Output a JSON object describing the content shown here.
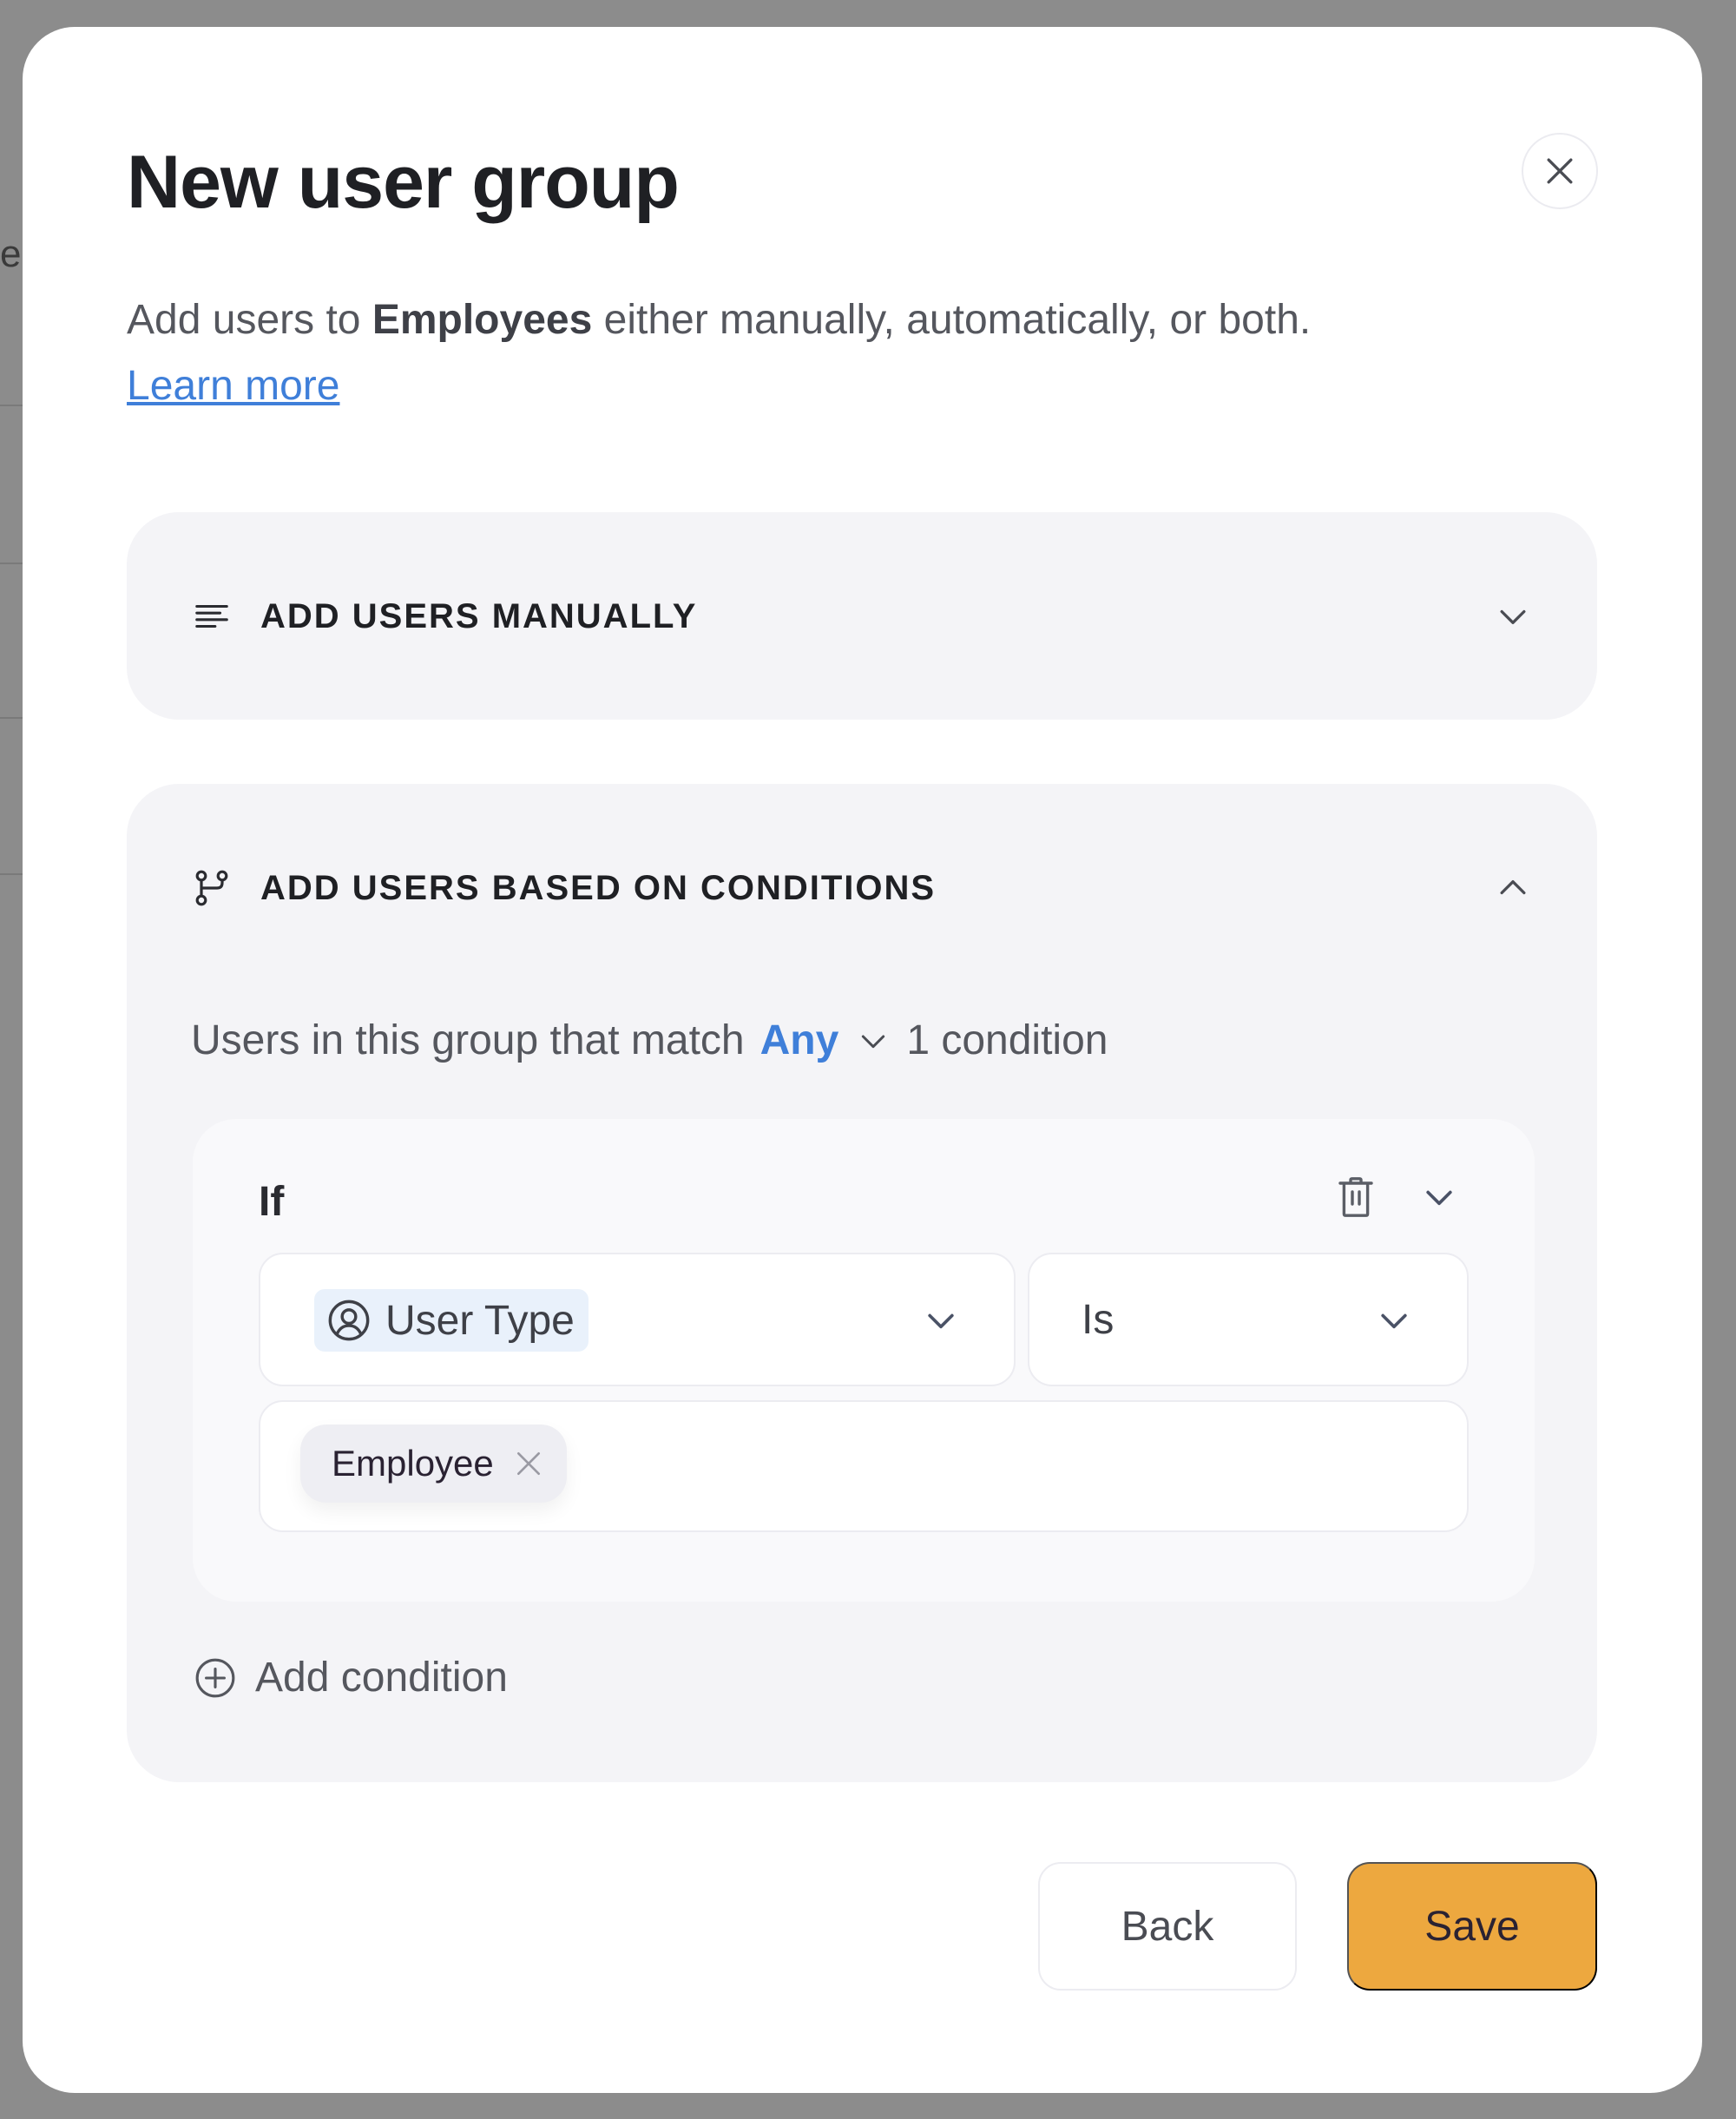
{
  "background": {
    "partial_text": "e"
  },
  "modal": {
    "title": "New user group",
    "subtitle_prefix": "Add users to ",
    "group_name": "Employees",
    "subtitle_suffix": " either manually, automatically, or both.",
    "learn_more_label": "Learn more",
    "close_icon": "close-icon"
  },
  "sections": [
    {
      "label": "ADD USERS MANUALLY",
      "icon": "list-lines-icon",
      "expanded": false,
      "chevron": "chevron-down-icon"
    },
    {
      "label": "ADD USERS BASED ON CONDITIONS",
      "icon": "git-branch-icon",
      "expanded": true,
      "chevron": "chevron-up-icon",
      "match_prefix": "Users in this group that match",
      "match_mode": "Any",
      "condition_count": "1 condition",
      "conditions": [
        {
          "if_label": "If",
          "attribute": "User Type",
          "attribute_icon": "user-circle-icon",
          "operator": "Is",
          "values": [
            "Employee"
          ]
        }
      ],
      "add_condition_label": "Add condition"
    }
  ],
  "footer": {
    "back_label": "Back",
    "save_label": "Save"
  },
  "colors": {
    "accent_blue": "#3f7fd9",
    "save_orange": "#eda83f",
    "section_bg": "#f4f4f7",
    "overlay": "#8c8c8c"
  }
}
